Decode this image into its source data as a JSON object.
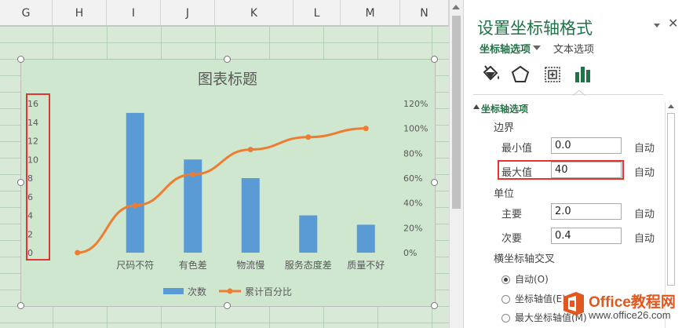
{
  "sheet": {
    "columns": [
      "G",
      "H",
      "I",
      "J",
      "K",
      "L",
      "M",
      "N"
    ]
  },
  "chart_data": {
    "type": "bar",
    "title": "图表标题",
    "categories": [
      "",
      "尺码不符",
      "有色差",
      "物流慢",
      "服务态度差",
      "质量不好"
    ],
    "series": [
      {
        "name": "次数",
        "type": "bar",
        "axis": "left",
        "values": [
          null,
          15,
          10,
          8,
          4,
          3
        ]
      },
      {
        "name": "累计百分比",
        "type": "line",
        "axis": "right",
        "values": [
          0,
          0.38,
          0.63,
          0.83,
          0.93,
          1.0
        ]
      }
    ],
    "y_left": {
      "ticks": [
        "0",
        "2",
        "4",
        "6",
        "8",
        "10",
        "12",
        "14",
        "16"
      ],
      "ylim": [
        0,
        16
      ]
    },
    "y_right": {
      "ticks": [
        "0%",
        "20%",
        "40%",
        "60%",
        "80%",
        "100%",
        "120%"
      ],
      "ylim": [
        0,
        1.2
      ]
    },
    "legend_position": "bottom",
    "colors": {
      "bar": "#5b9bd5",
      "line": "#ed7d31",
      "plot_bg": "#cfe6cf"
    }
  },
  "pane": {
    "title": "设置坐标轴格式",
    "tab_axis": "坐标轴选项",
    "tab_text": "文本选项",
    "icons": [
      "fill-bucket-icon",
      "pentagon-icon",
      "size-properties-icon",
      "bar-chart-icon"
    ],
    "section": "坐标轴选项",
    "bounds_label": "边界",
    "min_label": "最小值",
    "min_value": "0.0",
    "max_label": "最大值",
    "max_value": "40",
    "units_label": "单位",
    "major_label": "主要",
    "major_value": "2.0",
    "minor_label": "次要",
    "minor_value": "0.4",
    "auto_label": "自动",
    "cross_label": "横坐标轴交叉",
    "cross_auto": "自动(O)",
    "cross_value": "坐标轴值(E)",
    "cross_max": "最大坐标轴值(M)"
  },
  "watermark": {
    "name": "Office教程网",
    "url": "www.office26.com"
  },
  "accent_color": "#217346",
  "highlight_color": "#e5342f"
}
